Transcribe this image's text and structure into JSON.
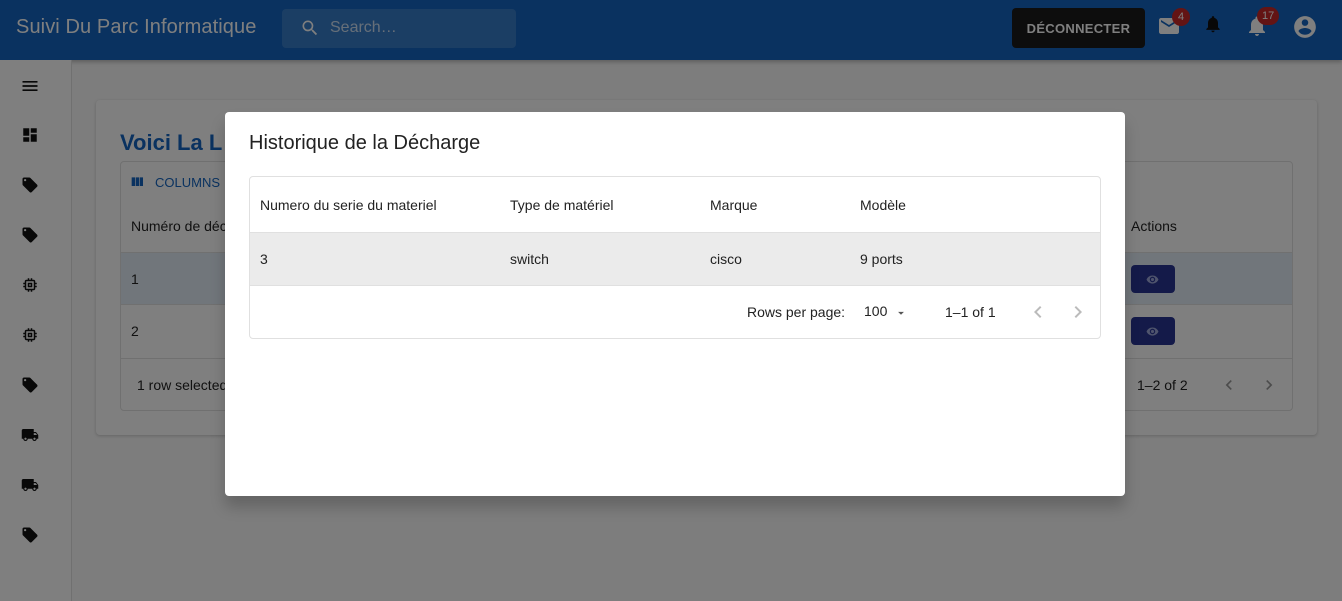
{
  "appbar": {
    "title": "Suivi Du Parc Informatique",
    "search_placeholder": "Search…",
    "logout_label": "DÉCONNECTER",
    "mail_badge": "4",
    "notifications_badge": "17",
    "accent": "#1565c0"
  },
  "sidebar": {
    "icons": [
      "menu-icon",
      "dashboard-icon",
      "tag-icon",
      "tag-icon",
      "chip-icon",
      "chip-icon",
      "tag-icon",
      "truck-icon",
      "truck-icon",
      "tag-icon"
    ]
  },
  "background": {
    "card_title": "Voici La L",
    "columns_label": "COLUMNS",
    "header_first": "Numéro de déc",
    "header_actions": "Actions",
    "rows": [
      {
        "value": "1"
      },
      {
        "value": "2"
      }
    ],
    "footer_selected": "1 row selected",
    "footer_range": "1–2 of 2"
  },
  "dialog": {
    "title": "Historique de la Décharge",
    "columns": [
      "Numero du serie du materiel",
      "Type de matériel",
      "Marque",
      "Modèle"
    ],
    "rows": [
      [
        "3",
        "switch",
        "cisco",
        "9 ports"
      ]
    ],
    "rows_per_page_label": "Rows per page:",
    "rows_per_page_value": "100",
    "range_label": "1–1 of 1"
  }
}
